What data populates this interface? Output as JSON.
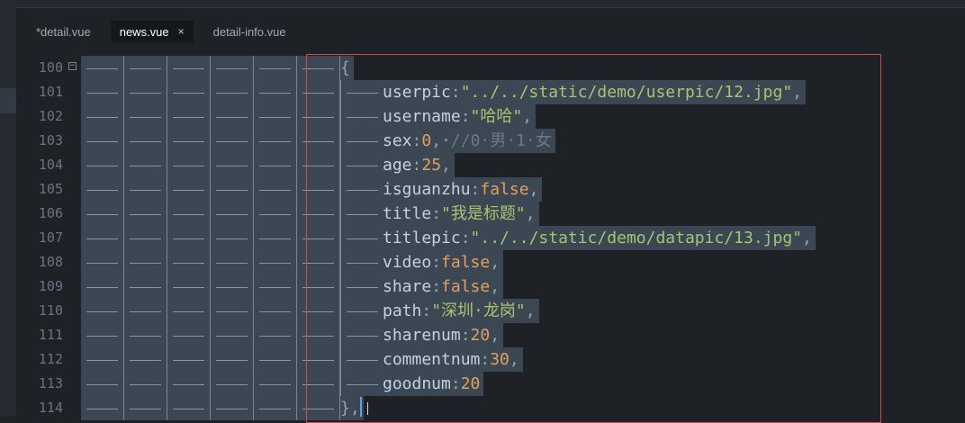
{
  "tabs": [
    {
      "label": "*detail.vue",
      "active": false
    },
    {
      "label": "news.vue",
      "active": true,
      "close": "×"
    },
    {
      "label": "detail-info.vue",
      "active": false
    }
  ],
  "editor": {
    "lines": [
      {
        "num": "100",
        "fold": "−",
        "code": [
          {
            "t": "{",
            "c": "p"
          }
        ]
      },
      {
        "num": "101",
        "code": [
          {
            "t": "userpic",
            "c": "k"
          },
          {
            "t": ":",
            "c": "p"
          },
          {
            "t": "\"../../static/demo/userpic/12.jpg\"",
            "c": "s"
          },
          {
            "t": ",",
            "c": "p"
          }
        ]
      },
      {
        "num": "102",
        "code": [
          {
            "t": "username",
            "c": "k"
          },
          {
            "t": ":",
            "c": "p"
          },
          {
            "t": "\"哈哈\"",
            "c": "s"
          },
          {
            "t": ",",
            "c": "p"
          }
        ]
      },
      {
        "num": "103",
        "code": [
          {
            "t": "sex",
            "c": "k"
          },
          {
            "t": ":",
            "c": "p"
          },
          {
            "t": "0",
            "c": "n"
          },
          {
            "t": ",·",
            "c": "p"
          },
          {
            "t": "//0·男·1·女",
            "c": "c"
          }
        ]
      },
      {
        "num": "104",
        "code": [
          {
            "t": "age",
            "c": "k"
          },
          {
            "t": ":",
            "c": "p"
          },
          {
            "t": "25",
            "c": "n"
          },
          {
            "t": ",",
            "c": "p"
          }
        ]
      },
      {
        "num": "105",
        "code": [
          {
            "t": "isguanzhu",
            "c": "k"
          },
          {
            "t": ":",
            "c": "p"
          },
          {
            "t": "false",
            "c": "n"
          },
          {
            "t": ",",
            "c": "p"
          }
        ]
      },
      {
        "num": "106",
        "code": [
          {
            "t": "title",
            "c": "k"
          },
          {
            "t": ":",
            "c": "p"
          },
          {
            "t": "\"我是标题\"",
            "c": "s"
          },
          {
            "t": ",",
            "c": "p"
          }
        ]
      },
      {
        "num": "107",
        "code": [
          {
            "t": "titlepic",
            "c": "k"
          },
          {
            "t": ":",
            "c": "p"
          },
          {
            "t": "\"../../static/demo/datapic/13.jpg\"",
            "c": "s"
          },
          {
            "t": ",",
            "c": "p"
          }
        ]
      },
      {
        "num": "108",
        "code": [
          {
            "t": "video",
            "c": "k"
          },
          {
            "t": ":",
            "c": "p"
          },
          {
            "t": "false",
            "c": "n"
          },
          {
            "t": ",",
            "c": "p"
          }
        ]
      },
      {
        "num": "109",
        "code": [
          {
            "t": "share",
            "c": "k"
          },
          {
            "t": ":",
            "c": "p"
          },
          {
            "t": "false",
            "c": "n"
          },
          {
            "t": ",",
            "c": "p"
          }
        ]
      },
      {
        "num": "110",
        "code": [
          {
            "t": "path",
            "c": "k"
          },
          {
            "t": ":",
            "c": "p"
          },
          {
            "t": "\"深圳·龙岗\"",
            "c": "s"
          },
          {
            "t": ",",
            "c": "p"
          }
        ]
      },
      {
        "num": "111",
        "code": [
          {
            "t": "sharenum",
            "c": "k"
          },
          {
            "t": ":",
            "c": "p"
          },
          {
            "t": "20",
            "c": "n"
          },
          {
            "t": ",",
            "c": "p"
          }
        ]
      },
      {
        "num": "112",
        "code": [
          {
            "t": "commentnum",
            "c": "k"
          },
          {
            "t": ":",
            "c": "p"
          },
          {
            "t": "30",
            "c": "n"
          },
          {
            "t": ",",
            "c": "p"
          }
        ]
      },
      {
        "num": "113",
        "code": [
          {
            "t": "goodnum",
            "c": "k"
          },
          {
            "t": ":",
            "c": "p"
          },
          {
            "t": "20",
            "c": "n"
          }
        ]
      },
      {
        "num": "114",
        "code": [
          {
            "t": "},",
            "c": "p"
          }
        ]
      }
    ]
  },
  "colors": {
    "background": "#1e2227",
    "selection": "#3c4754",
    "key": "#c7d1dc",
    "string": "#a8c46e",
    "number": "#e2a05a",
    "comment": "#6e7884",
    "frame": "#d54a4f",
    "caret": "#5a9cf5"
  }
}
